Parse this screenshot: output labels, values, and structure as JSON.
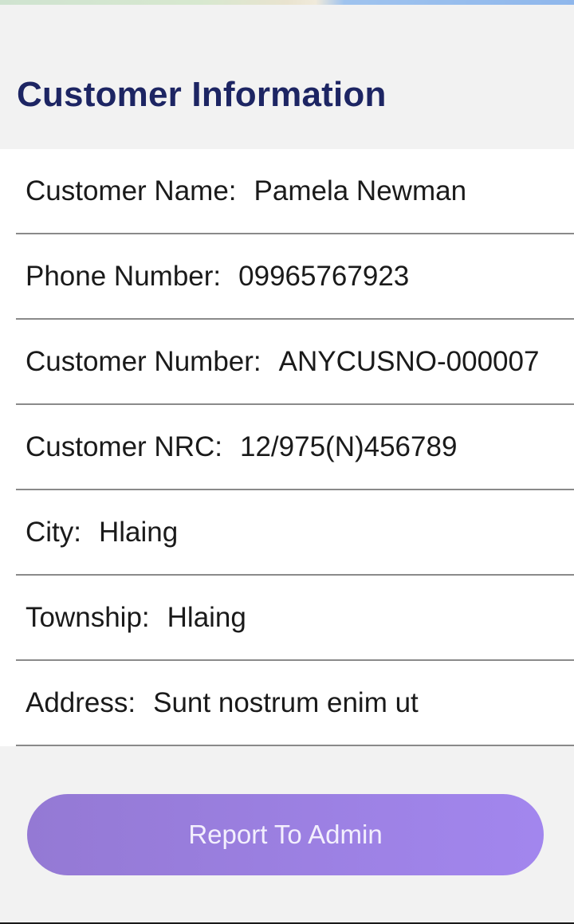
{
  "header": {
    "title": "Customer Information"
  },
  "fields": [
    {
      "label": "Customer Name:",
      "value": "Pamela Newman"
    },
    {
      "label": "Phone Number:",
      "value": "09965767923"
    },
    {
      "label": "Customer Number:",
      "value": "ANYCUSNO-000007"
    },
    {
      "label": "Customer NRC:",
      "value": "12/975(N)456789"
    },
    {
      "label": "City:",
      "value": "Hlaing"
    },
    {
      "label": "Township:",
      "value": "Hlaing"
    },
    {
      "label": "Address:",
      "value": "Sunt nostrum enim ut"
    }
  ],
  "actions": {
    "report_label": "Report To Admin"
  },
  "colors": {
    "title": "#1d2563",
    "button_start": "#9479d4",
    "button_end": "#a286ee",
    "divider": "#8a8a8a",
    "background": "#f2f2f2"
  }
}
